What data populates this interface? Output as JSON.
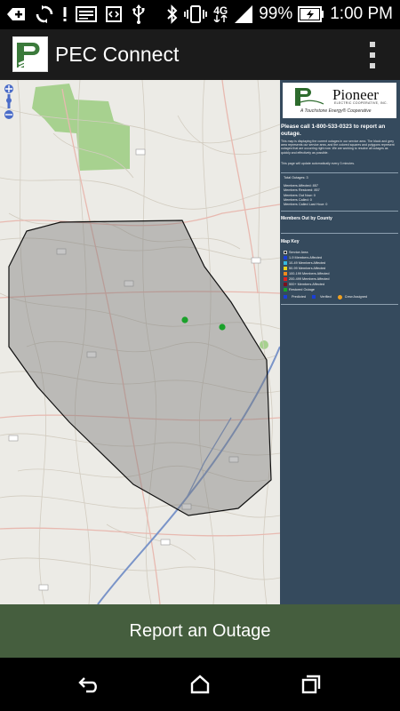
{
  "status_bar": {
    "battery_percent": "99%",
    "time": "1:00 PM",
    "network": "4G",
    "icons": [
      "add-box-icon",
      "sync-icon",
      "image-icon",
      "dev-mode-icon",
      "usb-icon",
      "bluetooth-icon",
      "vibrate-icon",
      "network-4g-icon",
      "signal-icon",
      "battery-charging-icon"
    ]
  },
  "app_bar": {
    "title": "PEC Connect",
    "logo": "pec-logo-icon",
    "menu_icon": "overflow-menu-icon"
  },
  "panel": {
    "logo_name": "Pioneer",
    "logo_sub": "ELECTRIC COOPERATIVE, INC.",
    "logo_tagline": "A Touchstone Energy® Cooperative",
    "call_text": "Please call 1-800-533-0323 to report an outage.",
    "info_text": "This map is displaying the current outages in our service area. The black and grey area represents our service area, and the colored squares and polygons represent outages that are occurring right now. We are working to resolve all outages as quickly and effectively as possible.",
    "auto_update": "This page will update automatically every 3 minutes.",
    "stats": {
      "total_outages": "Total Outages: 3",
      "members_affected": "Members Affected: 857",
      "members_restored": "Members Restored: 857",
      "members_out_now": "Members Out Now: 0",
      "members_called": "Members Called: 0",
      "members_called_last_hour": "Members Called Last Hour: 0"
    },
    "members_out_heading": "Members Out by County",
    "map_key_heading": "Map Key",
    "map_key": [
      {
        "label": "Service Area",
        "color": "#111111"
      },
      {
        "label": "1-9 Members Affected",
        "color": "#1a3fd6"
      },
      {
        "label": "10-49 Members Affected",
        "color": "#35b8e0"
      },
      {
        "label": "50-99 Members Affected",
        "color": "#e8d21c"
      },
      {
        "label": "100-199 Members Affected",
        "color": "#f08a1c"
      },
      {
        "label": "200-499 Members Affected",
        "color": "#e02020"
      },
      {
        "label": "500+ Members Affected",
        "color": "#7a1020"
      },
      {
        "label": "Restored Outage",
        "color": "#1aa12a"
      }
    ],
    "status_key": [
      {
        "label": "Predicted",
        "color": "#1a3fd6"
      },
      {
        "label": "Verified",
        "color": "#1a3fd6"
      },
      {
        "label": "Crew Assigned",
        "color": "#f0a020"
      }
    ]
  },
  "map": {
    "restored_points": 2,
    "zoom_control": "zoom-control-icon"
  },
  "report_button": {
    "label": "Report an Outage"
  },
  "nav_bar": {
    "back": "back-icon",
    "home": "home-icon",
    "recents": "recents-icon"
  }
}
